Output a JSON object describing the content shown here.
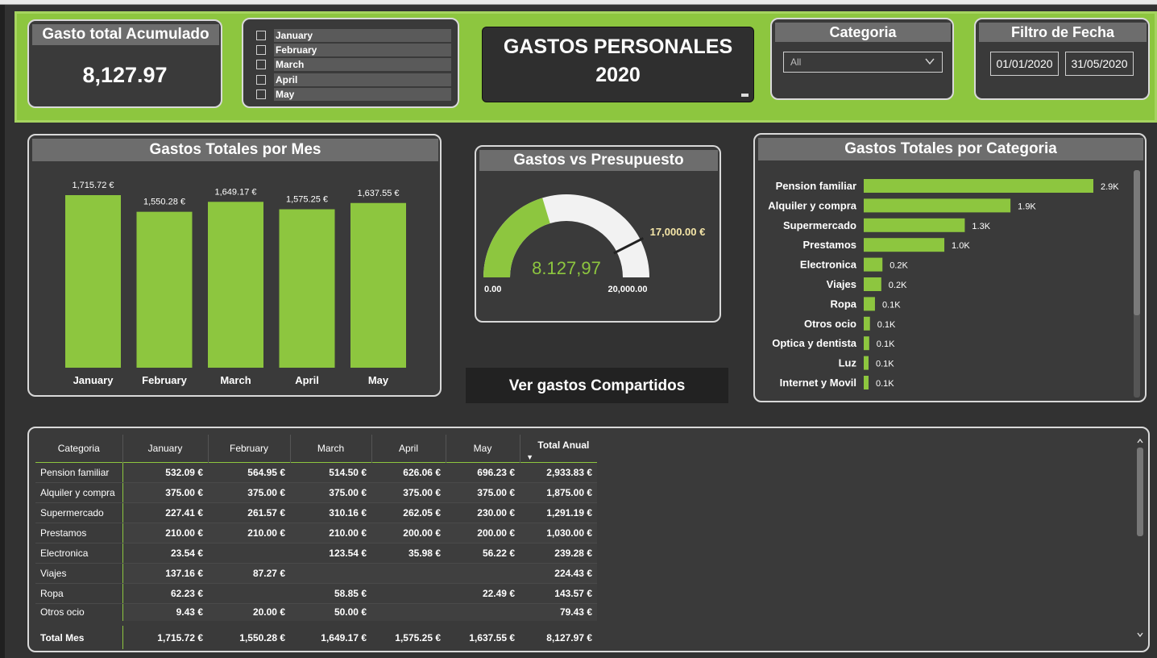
{
  "kpi": {
    "title": "Gasto total Acumulado",
    "value": "8,127.97"
  },
  "month_slicer": {
    "items": [
      "January",
      "February",
      "March",
      "April",
      "May"
    ]
  },
  "title": {
    "line1": "GASTOS PERSONALES",
    "line2": "2020"
  },
  "category_filter": {
    "title": "Categoria",
    "selected": "All"
  },
  "date_filter": {
    "title": "Filtro de Fecha",
    "start": "01/01/2020",
    "end": "31/05/2020"
  },
  "shared_button": {
    "label": "Ver gastos Compartidos"
  },
  "colors": {
    "accent": "#8dc63f",
    "panel": "#3a3a3a",
    "title_bar": "#6d6d6d",
    "target": "#f5e6a8",
    "gauge_bg": "#f2f2f2"
  },
  "chart_data": [
    {
      "type": "bar",
      "title": "Gastos Totales por Mes",
      "categories": [
        "January",
        "February",
        "March",
        "April",
        "May"
      ],
      "values": [
        1715.72,
        1550.28,
        1649.17,
        1575.25,
        1637.55
      ],
      "data_labels": [
        "1,715.72 €",
        "1,550.28 €",
        "1,649.17 €",
        "1,575.25 €",
        "1,637.55 €"
      ],
      "ylim": [
        0,
        1715.72
      ]
    },
    {
      "type": "gauge",
      "title": "Gastos vs Presupuesto",
      "value": 8127.97,
      "value_label": "8.127,97",
      "min": 0,
      "max": 20000,
      "min_label": "0.00",
      "max_label": "20,000.00",
      "target": 17000,
      "target_label": "17,000.00 €"
    },
    {
      "type": "bar",
      "orientation": "horizontal",
      "title": "Gastos Totales por Categoria",
      "categories": [
        "Pension familiar",
        "Alquiler y compra",
        "Supermercado",
        "Prestamos",
        "Electronica",
        "Viajes",
        "Ropa",
        "Otros ocio",
        "Optica y dentista",
        "Luz",
        "Internet y Movil"
      ],
      "values": [
        2933.83,
        1875.0,
        1291.19,
        1030.0,
        239.28,
        224.43,
        143.57,
        79.43,
        70,
        60,
        55
      ],
      "data_labels": [
        "2.9K",
        "1.9K",
        "1.3K",
        "1.0K",
        "0.2K",
        "0.2K",
        "0.1K",
        "0.1K",
        "0.1K",
        "0.1K",
        "0.1K"
      ]
    }
  ],
  "table": {
    "headers": [
      "Categoria",
      "January",
      "February",
      "March",
      "April",
      "May",
      "Total Anual"
    ],
    "rows": [
      [
        "Pension familiar",
        "532.09 €",
        "564.95 €",
        "514.50 €",
        "626.06 €",
        "696.23 €",
        "2,933.83 €"
      ],
      [
        "Alquiler y compra",
        "375.00 €",
        "375.00 €",
        "375.00 €",
        "375.00 €",
        "375.00 €",
        "1,875.00 €"
      ],
      [
        "Supermercado",
        "227.41 €",
        "261.57 €",
        "310.16 €",
        "262.05 €",
        "230.00 €",
        "1,291.19 €"
      ],
      [
        "Prestamos",
        "210.00 €",
        "210.00 €",
        "210.00 €",
        "200.00 €",
        "200.00 €",
        "1,030.00 €"
      ],
      [
        "Electronica",
        "23.54 €",
        "",
        "123.54 €",
        "35.98 €",
        "56.22 €",
        "239.28 €"
      ],
      [
        "Viajes",
        "137.16 €",
        "87.27 €",
        "",
        "",
        "",
        "224.43 €"
      ],
      [
        "Ropa",
        "62.23 €",
        "",
        "58.85 €",
        "",
        "22.49 €",
        "143.57 €"
      ],
      [
        "Otros ocio",
        "9.43 €",
        "20.00 €",
        "50.00 €",
        "",
        "",
        "79.43 €"
      ]
    ],
    "total": [
      "Total Mes",
      "1,715.72 €",
      "1,550.28 €",
      "1,649.17 €",
      "1,575.25 €",
      "1,637.55 €",
      "8,127.97 €"
    ]
  }
}
